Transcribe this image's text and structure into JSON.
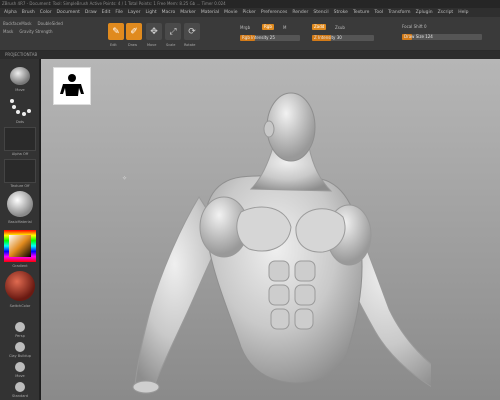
{
  "window": {
    "title_text": "ZBrush 4R7 - Document:  Tool: SimpleBrush  Active Points: 4 / 1 Total Points: 1 Free Mem: 8.25 Gb ... Timer 0.024"
  },
  "menu": {
    "items": [
      "Alpha",
      "Brush",
      "Color",
      "Document",
      "Draw",
      "Edit",
      "File",
      "Layer",
      "Light",
      "Macro",
      "Marker",
      "Material",
      "Movie",
      "Picker",
      "Preferences",
      "Render",
      "Stencil",
      "Stroke",
      "Texture",
      "Tool",
      "Transform",
      "Zplugin",
      "Zscript",
      "Help"
    ]
  },
  "toolbar": {
    "left_row1": [
      "BackfaceMask",
      "DoubleSided"
    ],
    "left_row2": [
      "Mask",
      "Gravity Strength"
    ],
    "mode_buttons": [
      {
        "label": "Edit",
        "icon": "✎",
        "state": "active"
      },
      {
        "label": "Draw",
        "icon": "✐",
        "state": "active"
      },
      {
        "label": "Move",
        "icon": "✥",
        "state": "inactive"
      },
      {
        "label": "Scale",
        "icon": "⤢",
        "state": "inactive"
      },
      {
        "label": "Rotate",
        "icon": "⟳",
        "state": "inactive"
      }
    ],
    "mrgb": "Mrgb",
    "rgb": "Rgb",
    "m": "M",
    "rgb_intensity_label": "Rgb Intensity 25",
    "rgb_intensity_value": 25,
    "zadd": "Zadd",
    "zsub": "Zsub",
    "z_intensity_label": "Z Intensity 30",
    "z_intensity_value": 30,
    "focal_shift_label": "Focal Shift 0",
    "draw_size_label": "Draw Size 124",
    "draw_size_value": 124
  },
  "subbar": {
    "text": "PROJECTIONTAB"
  },
  "left_panel": {
    "brush_label": "Move",
    "stroke_label": "Dots",
    "alpha_label": "Alpha Off",
    "texture_label": "Texture Off",
    "material_label": "BasicMaterial",
    "gradient_label": "Gradient",
    "switch_label": "SwitchColor",
    "buttons": [
      "Persp",
      "Clay Buildup",
      "Move",
      "Standard"
    ]
  },
  "colors": {
    "accent": "#e08a1e",
    "viewport_top": "#b6b6b6",
    "viewport_bottom": "#8a8a8a",
    "panel": "#333333"
  }
}
